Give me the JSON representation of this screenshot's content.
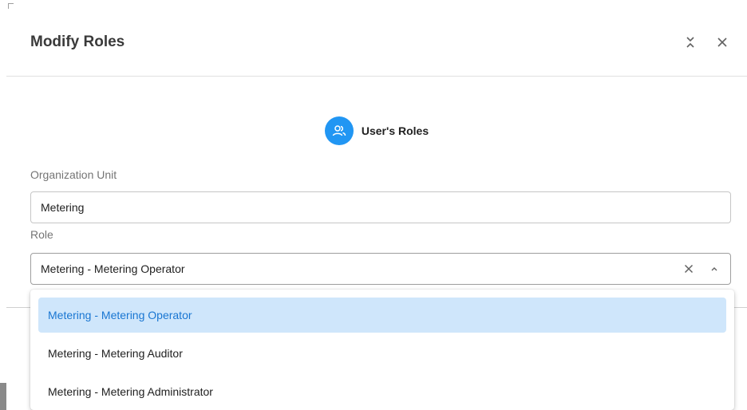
{
  "dialog": {
    "title": "Modify Roles",
    "actions": {
      "collapse_icon": "collapse-icon",
      "close_icon": "close-icon"
    }
  },
  "section": {
    "icon": "users-icon",
    "label": "User's Roles",
    "accent": "#2196f3"
  },
  "org_unit": {
    "label": "Organization Unit",
    "value": "Metering"
  },
  "role": {
    "label": "Role",
    "value": "Metering - Metering Operator",
    "options": [
      {
        "label": "Metering - Metering Operator",
        "selected": true
      },
      {
        "label": "Metering - Metering Auditor",
        "selected": false
      },
      {
        "label": "Metering - Metering Administrator",
        "selected": false
      }
    ],
    "selected_color": "#1976d2",
    "selected_bg": "#cfe6fb"
  }
}
